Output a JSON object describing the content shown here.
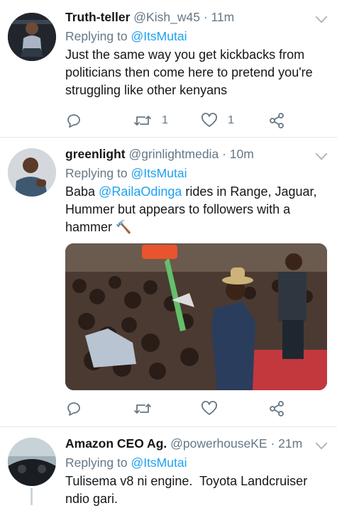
{
  "tweets": [
    {
      "name": "Truth-teller",
      "handle": "@Kish_w45",
      "time": "· 11m",
      "replying_prefix": "Replying to",
      "replying_to": "@ItsMutai",
      "text": "Just the same way you get kickbacks from politicians then come here to pretend you're struggling like other kenyans",
      "retweets": "1",
      "likes": "1"
    },
    {
      "name": "greenlight",
      "handle": "@grinlightmedia",
      "time": "· 10m",
      "replying_prefix": "Replying to",
      "replying_to": "@ItsMutai",
      "text_before": "Baba ",
      "mention": "@RailaOdinga",
      "text_after": " rides in Range, Jaguar, Hummer but appears to followers with a hammer",
      "emoji": "🔨",
      "retweets": "",
      "likes": ""
    },
    {
      "name": "Amazon CEO Ag.",
      "handle": "@powerhouseKE",
      "time": "· 21m",
      "replying_prefix": "Replying to",
      "replying_to": "@ItsMutai",
      "text": "Tulisema v8 ni engine.  Toyota Landcruiser ndio gari."
    }
  ],
  "icons": {
    "reply": "reply-icon",
    "retweet": "retweet-icon",
    "like": "heart-icon",
    "share": "share-icon",
    "caret": "chevron-down-icon"
  },
  "colors": {
    "link": "#1da1f2",
    "secondary_text": "#657786",
    "divider": "#e1e8ed"
  }
}
